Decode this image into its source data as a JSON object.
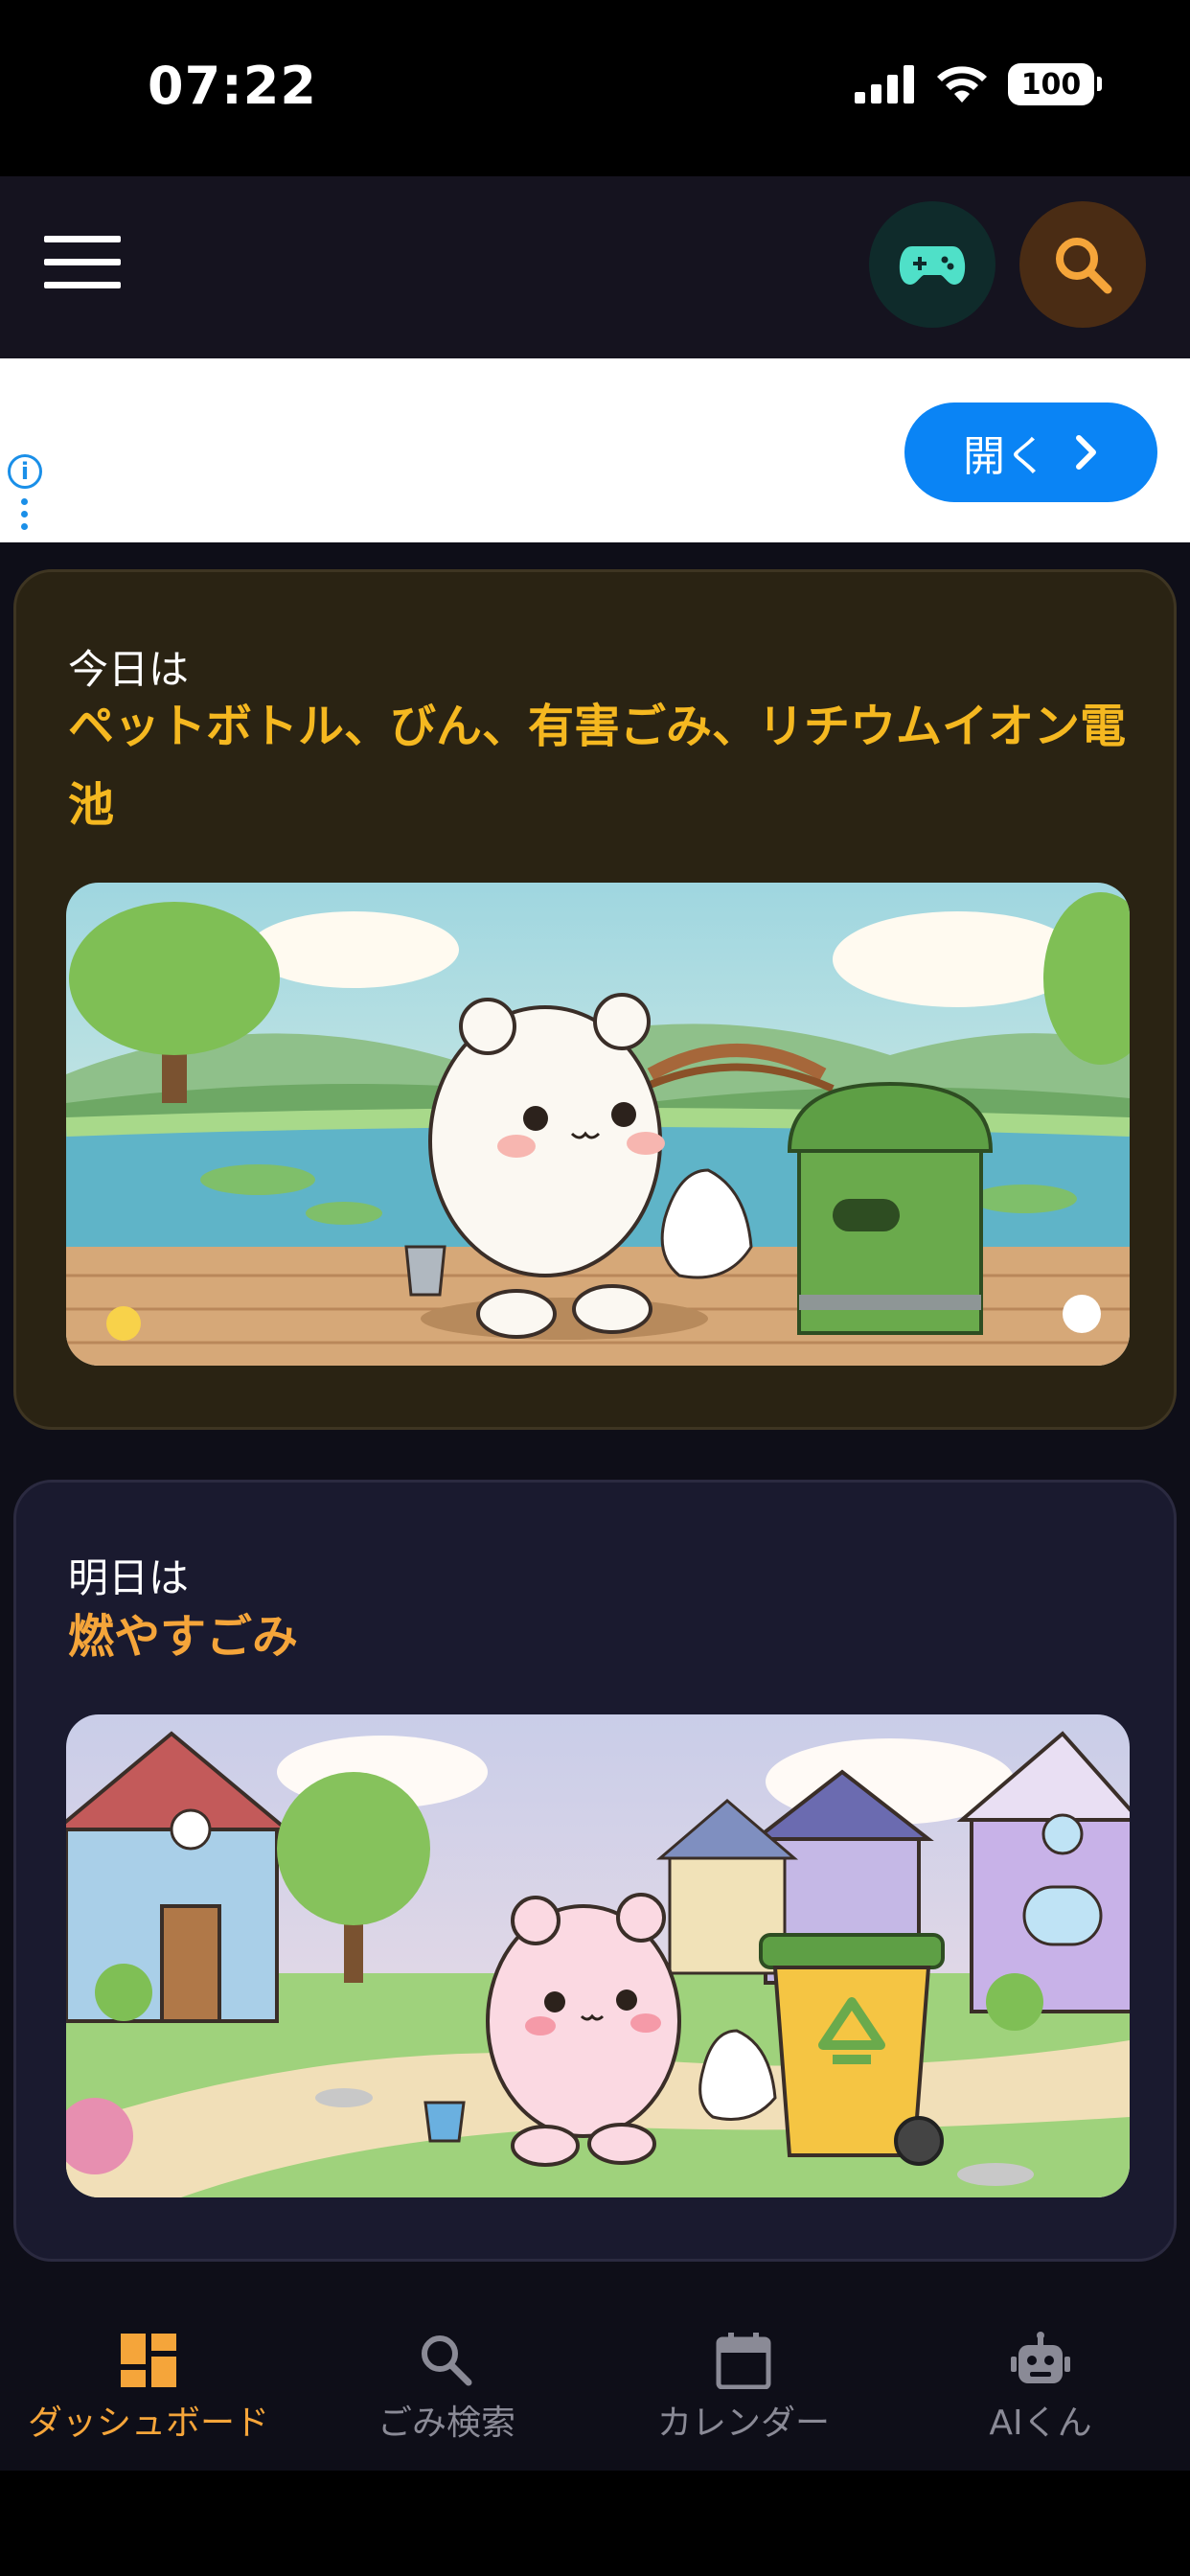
{
  "status_bar": {
    "time": "07:22",
    "battery": "100",
    "icons": [
      "cellular-signal-icon",
      "wifi-icon",
      "battery-icon"
    ]
  },
  "header": {
    "menu_icon": "hamburger-menu-icon",
    "game_icon": "gamepad-icon",
    "search_icon": "search-icon",
    "colors": {
      "game_bg": "#0f2b2b",
      "game_fg": "#4fe0c8",
      "search_bg": "#4a2c14",
      "search_fg": "#f5a53a"
    }
  },
  "ad": {
    "open_label": "開く",
    "info_icon": "info-icon",
    "arrow_icon": "chevron-right-icon",
    "button_color": "#0a84f5"
  },
  "today": {
    "label": "今日は",
    "value": "ペットボトル、びん、有害ごみ、リチウムイオン電池",
    "accent": "#f5b820"
  },
  "tomorrow": {
    "label": "明日は",
    "value": "燃やすごみ",
    "accent": "#f5a53a"
  },
  "nav": {
    "items": [
      {
        "label": "ダッシュボード",
        "icon": "dashboard-icon",
        "active": true
      },
      {
        "label": "ごみ検索",
        "icon": "search-icon",
        "active": false
      },
      {
        "label": "カレンダー",
        "icon": "calendar-icon",
        "active": false
      },
      {
        "label": "AIくん",
        "icon": "robot-icon",
        "active": false
      }
    ],
    "active_color": "#f5a53a",
    "inactive_color": "#8a8a96"
  }
}
